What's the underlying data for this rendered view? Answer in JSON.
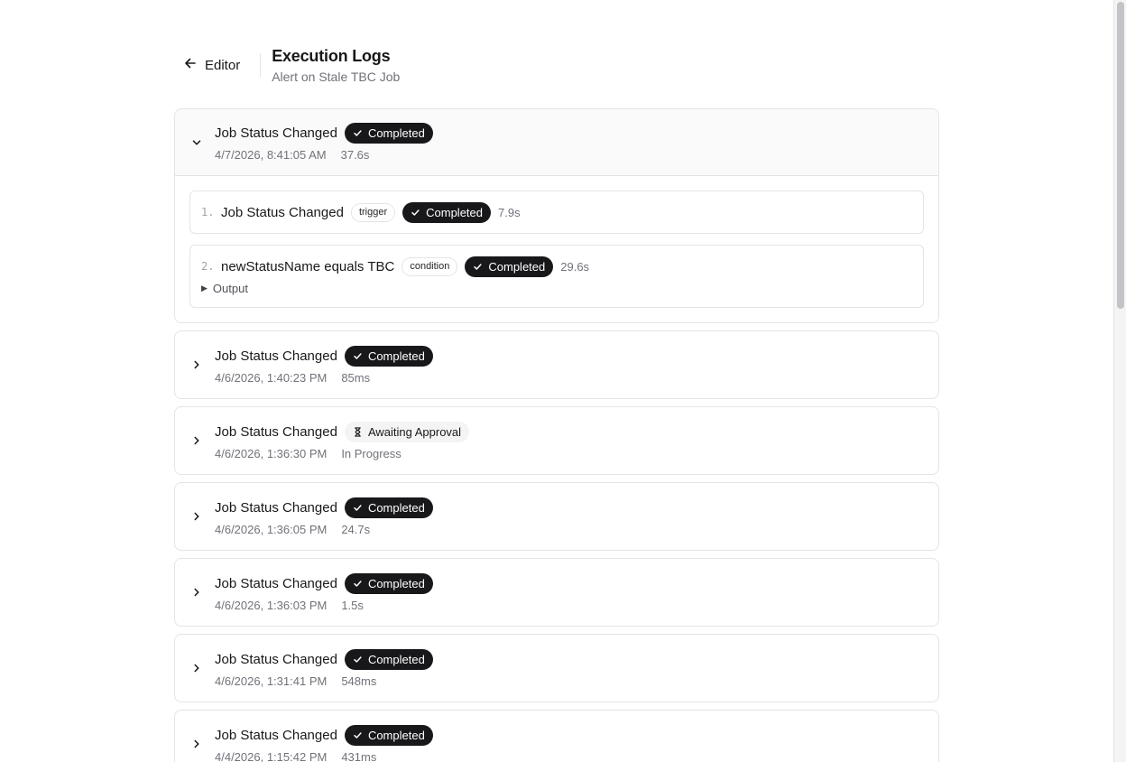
{
  "header": {
    "back_label": "Editor",
    "title": "Execution Logs",
    "subtitle": "Alert on Stale TBC Job"
  },
  "logs": [
    {
      "title": "Job Status Changed",
      "status": "Completed",
      "status_kind": "done",
      "timestamp": "4/7/2026, 8:41:05 AM",
      "duration": "37.6s",
      "expanded": true,
      "steps": [
        {
          "num": "1.",
          "name": "Job Status Changed",
          "tag": "trigger",
          "status": "Completed",
          "duration": "7.9s",
          "output": null
        },
        {
          "num": "2.",
          "name": "newStatusName equals TBC",
          "tag": "condition",
          "status": "Completed",
          "duration": "29.6s",
          "output": "Output"
        }
      ]
    },
    {
      "title": "Job Status Changed",
      "status": "Completed",
      "status_kind": "done",
      "timestamp": "4/6/2026, 1:40:23 PM",
      "duration": "85ms",
      "expanded": false
    },
    {
      "title": "Job Status Changed",
      "status": "Awaiting Approval",
      "status_kind": "pending",
      "timestamp": "4/6/2026, 1:36:30 PM",
      "duration": "In Progress",
      "expanded": false
    },
    {
      "title": "Job Status Changed",
      "status": "Completed",
      "status_kind": "done",
      "timestamp": "4/6/2026, 1:36:05 PM",
      "duration": "24.7s",
      "expanded": false
    },
    {
      "title": "Job Status Changed",
      "status": "Completed",
      "status_kind": "done",
      "timestamp": "4/6/2026, 1:36:03 PM",
      "duration": "1.5s",
      "expanded": false
    },
    {
      "title": "Job Status Changed",
      "status": "Completed",
      "status_kind": "done",
      "timestamp": "4/6/2026, 1:31:41 PM",
      "duration": "548ms",
      "expanded": false
    },
    {
      "title": "Job Status Changed",
      "status": "Completed",
      "status_kind": "done",
      "timestamp": "4/4/2026, 1:15:42 PM",
      "duration": "431ms",
      "expanded": false
    }
  ],
  "colors": {
    "badge_done_bg": "#18181b",
    "badge_pending_bg": "#f4f4f5",
    "border": "#e4e4e7",
    "muted_text": "#71717a"
  },
  "icons": {
    "back": "arrow-left-icon",
    "expanded": "chevron-down-icon",
    "collapsed": "chevron-right-icon",
    "done": "check-icon",
    "pending": "hourglass-icon"
  }
}
